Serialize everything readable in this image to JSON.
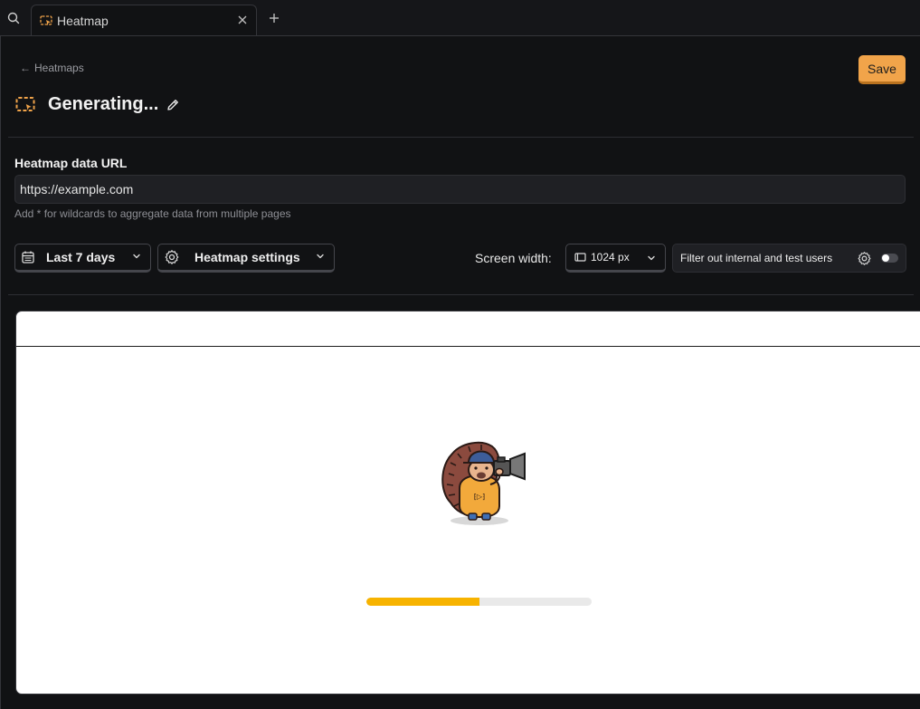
{
  "tabbar": {
    "tab_label": "Heatmap",
    "icons": [
      "search-icon",
      "heatmap-icon",
      "close-icon",
      "plus-icon"
    ]
  },
  "header": {
    "breadcrumb_arrow": "←",
    "breadcrumb_label": "Heatmaps",
    "save_label": "Save",
    "title": "Generating...",
    "title_icon": "heatmap-icon",
    "edit_icon": "pencil-icon"
  },
  "url_section": {
    "label": "Heatmap data URL",
    "value": "https://example.com",
    "help": "Add * for wildcards to aggregate data from multiple pages"
  },
  "controls": {
    "date_label": "Last 7 days",
    "settings_label": "Heatmap settings",
    "screen_width_label": "Screen width:",
    "screen_width_value": "1024 px",
    "filter_label": "Filter out internal and test users",
    "filter_enabled": false
  },
  "preview": {
    "loading_progress_percent": 50,
    "illustration": "hedgehog-with-camera"
  },
  "colors": {
    "accent": "#f1a44a",
    "progress": "#f7b300",
    "background": "#111214"
  }
}
